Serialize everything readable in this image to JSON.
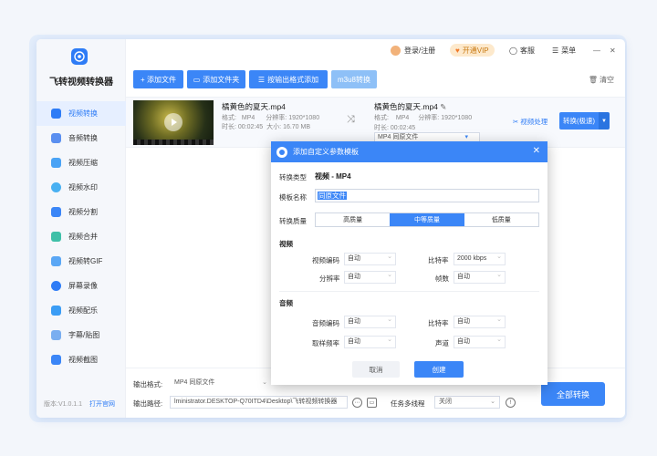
{
  "app": {
    "name": "飞转视频转换器",
    "accent": "#3b86f7"
  },
  "topbar": {
    "login": "登录/注册",
    "vip": "开通VIP",
    "support": "客服",
    "menu": "菜单",
    "minimize": "—",
    "close": "✕"
  },
  "sidebar": {
    "items": [
      {
        "label": "视频转换",
        "icon": "video-convert-icon",
        "color": "#2e7cf6"
      },
      {
        "label": "音频转换",
        "icon": "audio-convert-icon",
        "color": "#5a8ff0"
      },
      {
        "label": "视频压缩",
        "icon": "video-compress-icon",
        "color": "#4aa3f5"
      },
      {
        "label": "视频水印",
        "icon": "watermark-icon",
        "color": "#49b0f2"
      },
      {
        "label": "视频分割",
        "icon": "video-split-icon",
        "color": "#3b86f7"
      },
      {
        "label": "视频合并",
        "icon": "video-merge-icon",
        "color": "#3fc0a8"
      },
      {
        "label": "视频转GIF",
        "icon": "gif-icon",
        "color": "#5aa7f5"
      },
      {
        "label": "屏幕录像",
        "icon": "screen-record-icon",
        "color": "#2e7cf6"
      },
      {
        "label": "视频配乐",
        "icon": "music-icon",
        "color": "#3b9df5"
      },
      {
        "label": "字幕/贴图",
        "icon": "subtitle-icon",
        "color": "#7aaef0"
      },
      {
        "label": "视频截图",
        "icon": "screenshot-icon",
        "color": "#3b86f7"
      }
    ],
    "version": "版本:V1.0.1.1",
    "website": "打开官网"
  },
  "toolbar": {
    "add_file": "+ 添加文件",
    "add_folder": "添加文件夹",
    "batch_add": "按输出格式添加",
    "m3u8": "m3u8转换",
    "clear": "清空"
  },
  "file": {
    "name": "橘黄色的夏天.mp4",
    "src_format_label": "格式:",
    "src_format": "MP4",
    "src_res_label": "分辨率:",
    "src_res": "1920*1080",
    "src_dur_label": "时长:",
    "src_dur": "00:02:45",
    "src_size_label": "大小:",
    "src_size": "16.70 MB",
    "out_name": "橘黄色的夏天.mp4",
    "out_format_label": "格式:",
    "out_format": "MP4",
    "out_res_label": "分辨率:",
    "out_res": "1920*1080",
    "out_dur_label": "时长:",
    "out_dur": "00:02:45",
    "out_preset": "MP4  同原文件",
    "edit": "视频处理",
    "convert": "转换(极速)"
  },
  "bottom": {
    "format_label": "输出格式:",
    "format_value": "MP4  同原文件",
    "path_label": "输出路径:",
    "path_value": "lministrator.DESKTOP-Q70ITD4\\Desktop\\飞转视频转换器",
    "multi_label": "任务多线程",
    "multi_value": "关闭",
    "convert_all": "全部转换"
  },
  "dialog": {
    "title": "添加自定义参数模板",
    "type_label": "转换类型",
    "type_value": "视频 - MP4",
    "name_label": "模板名称",
    "name_value": "同原文件",
    "quality_label": "转换质量",
    "quality_options": [
      "高质量",
      "中等质量",
      "低质量"
    ],
    "video_section": "视频",
    "video_codec_label": "视频编码",
    "video_codec": "自动",
    "video_bitrate_label": "比特率",
    "video_bitrate": "2000 kbps",
    "resolution_label": "分辨率",
    "resolution": "自动",
    "fps_label": "帧数",
    "fps": "自动",
    "audio_section": "音频",
    "audio_codec_label": "音频编码",
    "audio_codec": "自动",
    "audio_bitrate_label": "比特率",
    "audio_bitrate": "自动",
    "sample_label": "取样频率",
    "sample": "自动",
    "channel_label": "声道",
    "channel": "自动",
    "cancel": "取消",
    "create": "创建"
  }
}
